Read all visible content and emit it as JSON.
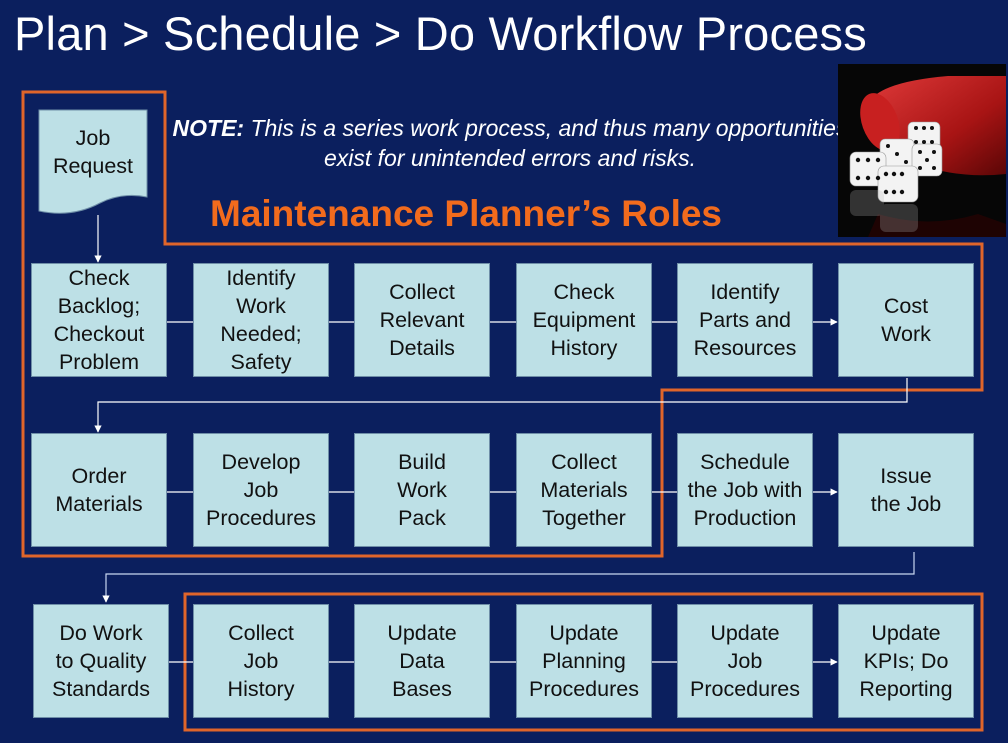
{
  "title": "Plan > Schedule > Do Workflow Process",
  "note": {
    "label": "NOTE:",
    "text": " This is a series work process, and thus many opportunities exist for unintended errors and risks."
  },
  "section_heading": "Maintenance Planner’s Roles",
  "start_node": {
    "label": "Job\nRequest"
  },
  "rows": [
    {
      "steps": [
        {
          "label": "Check\nBacklog;\nCheckout\nProblem"
        },
        {
          "label": "Identify\nWork\nNeeded;\nSafety"
        },
        {
          "label": "Collect\nRelevant\nDetails"
        },
        {
          "label": "Check\nEquipment\nHistory"
        },
        {
          "label": "Identify\nParts and\nResources"
        },
        {
          "label": "Cost\nWork"
        }
      ]
    },
    {
      "steps": [
        {
          "label": "Order\nMaterials"
        },
        {
          "label": "Develop\nJob\nProcedures"
        },
        {
          "label": "Build\nWork\nPack"
        },
        {
          "label": "Collect\nMaterials\nTogether"
        },
        {
          "label": "Schedule\nthe Job with\nProduction"
        },
        {
          "label": "Issue\nthe Job"
        }
      ]
    },
    {
      "steps": [
        {
          "label": "Do Work\nto Quality\nStandards"
        },
        {
          "label": "Collect\nJob\nHistory"
        },
        {
          "label": "Update\nData\nBases"
        },
        {
          "label": "Update\nPlanning\nProcedures"
        },
        {
          "label": "Update\nJob\nProcedures"
        },
        {
          "label": "Update\nKPIs; Do\nReporting"
        }
      ]
    }
  ],
  "image": {
    "subject": "red dice cup with spilled white dice",
    "icon": "dice-cup-image"
  },
  "colors": {
    "background": "#0b1f5e",
    "box_fill": "#bde0e6",
    "planner_frame": "#e0652a",
    "heading": "#f26b1d",
    "connector": "#ffffff"
  }
}
